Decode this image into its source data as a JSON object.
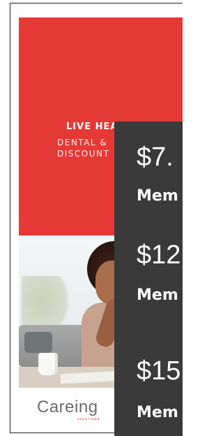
{
  "brochure": {
    "tagline": "LIVE HEALTHY",
    "subline_1": "DENTAL &",
    "subline_2": "DISCOUNT",
    "logo_text": "Careing",
    "logo_sub": "SOLUTIONS",
    "accent_color": "#e53935"
  },
  "overlay": {
    "background_color": "#3a3a3a",
    "items": [
      {
        "price": "$7.",
        "label": "Mem"
      },
      {
        "price": "$12",
        "label": "Mem"
      },
      {
        "price": "$15",
        "label": "Mem"
      }
    ]
  }
}
